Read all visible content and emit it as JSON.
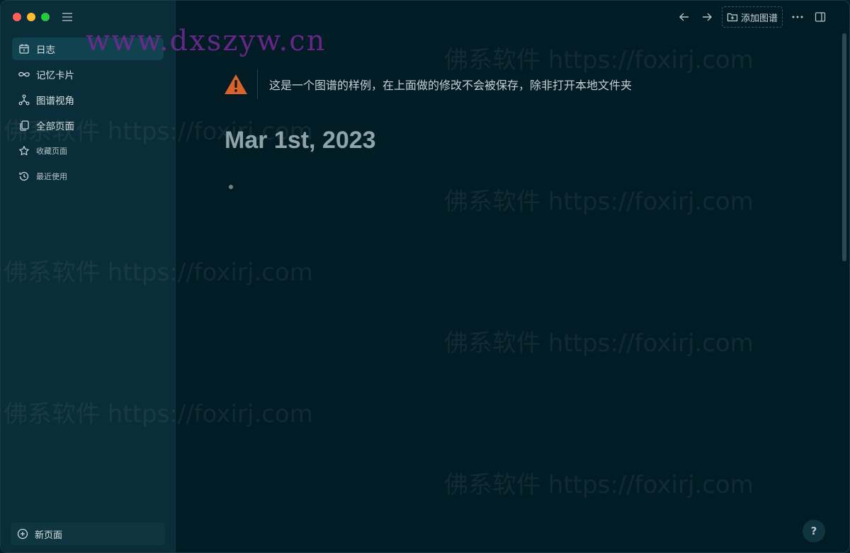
{
  "sidebar": {
    "items": [
      {
        "label": "日志",
        "icon": "calendar-icon",
        "active": true
      },
      {
        "label": "记忆卡片",
        "icon": "infinity-icon"
      },
      {
        "label": "图谱视角",
        "icon": "graph-icon"
      },
      {
        "label": "全部页面",
        "icon": "pages-icon"
      },
      {
        "label": "收藏页面",
        "icon": "star-icon"
      },
      {
        "label": "最近使用",
        "icon": "history-icon"
      }
    ],
    "new_page_label": "新页面"
  },
  "toolbar": {
    "add_graph_label": "添加图谱"
  },
  "main": {
    "notice": "这是一个图谱的样例，在上面做的修改不会被保存，除非打开本地文件夹",
    "journal_date": "Mar 1st, 2023"
  },
  "help_label": "?",
  "watermarks": {
    "top": "www.dxszyw.cn",
    "repeat": "佛系软件 https://foxirj.com"
  },
  "colors": {
    "sidebar_bg": "#0a2e39",
    "main_bg": "#021c25",
    "warning": "#d9632a"
  }
}
